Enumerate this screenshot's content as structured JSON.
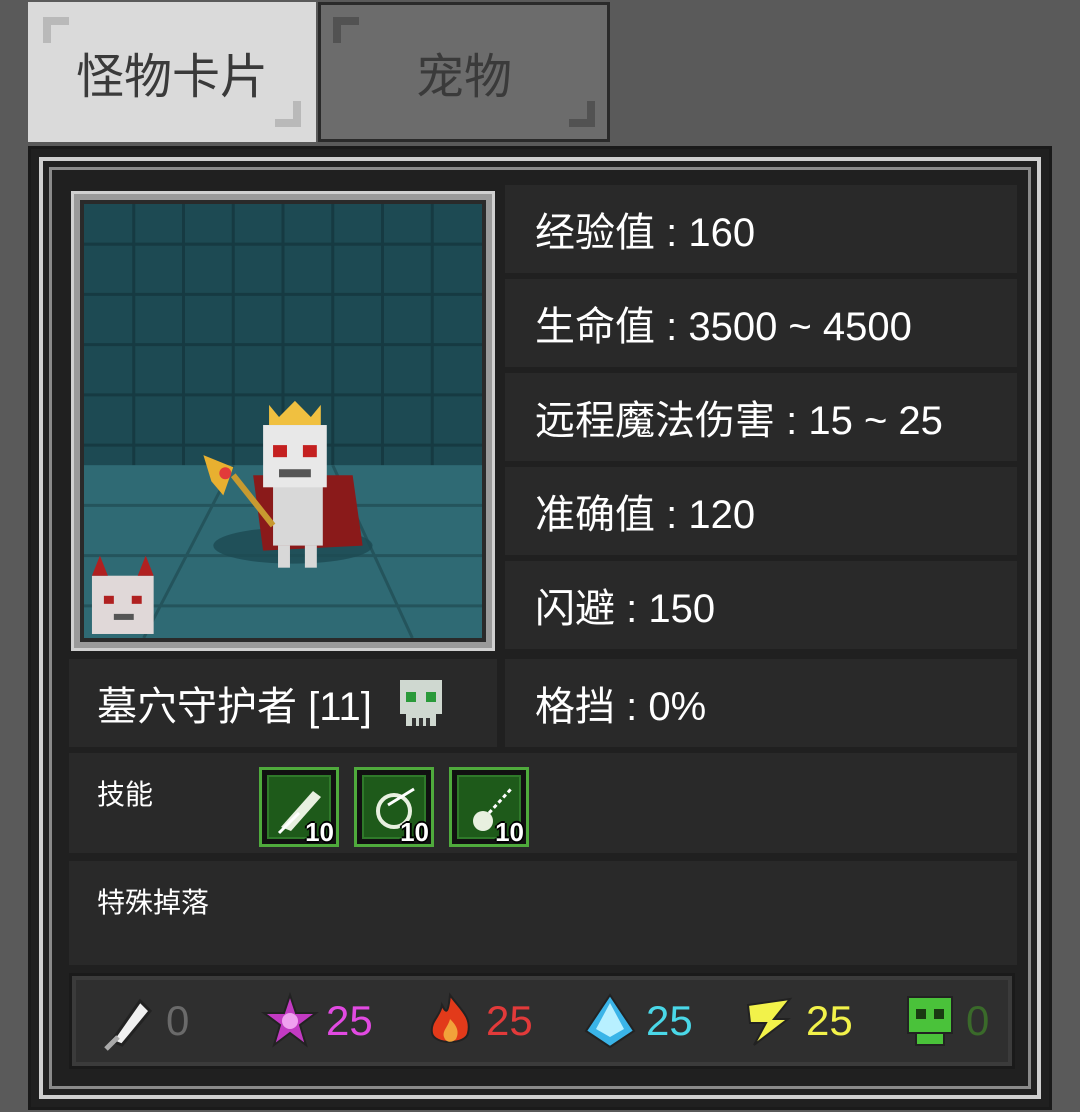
{
  "tabs": [
    {
      "label": "怪物卡片",
      "active": true
    },
    {
      "label": "宠物",
      "active": false
    }
  ],
  "monster": {
    "name": "墓穴守护者 [11]",
    "type_icon": "skull-icon"
  },
  "stats": [
    {
      "text": "经验值 : 160"
    },
    {
      "text": "生命值 : 3500 ~ 4500"
    },
    {
      "text": "远程魔法伤害 : 15 ~ 25"
    },
    {
      "text": "准确值 : 120"
    },
    {
      "text": "闪避 : 150"
    },
    {
      "text": "格挡 : 0%"
    }
  ],
  "skills": {
    "label": "技能",
    "items": [
      {
        "icon": "feather-skill-icon",
        "level": "10"
      },
      {
        "icon": "swirl-skill-icon",
        "level": "10"
      },
      {
        "icon": "orb-skill-icon",
        "level": "10"
      }
    ]
  },
  "drops": {
    "label": "特殊掉落"
  },
  "resistances": [
    {
      "icon": "physical-icon",
      "value": "0",
      "color": "#6a6a6a"
    },
    {
      "icon": "arcane-icon",
      "value": "25",
      "color": "#e24ae2"
    },
    {
      "icon": "fire-icon",
      "value": "25",
      "color": "#e23a3a"
    },
    {
      "icon": "ice-icon",
      "value": "25",
      "color": "#4ad8e8"
    },
    {
      "icon": "lightning-icon",
      "value": "25",
      "color": "#f2f24a"
    },
    {
      "icon": "poison-icon",
      "value": "0",
      "color": "#3a6a2a"
    }
  ]
}
